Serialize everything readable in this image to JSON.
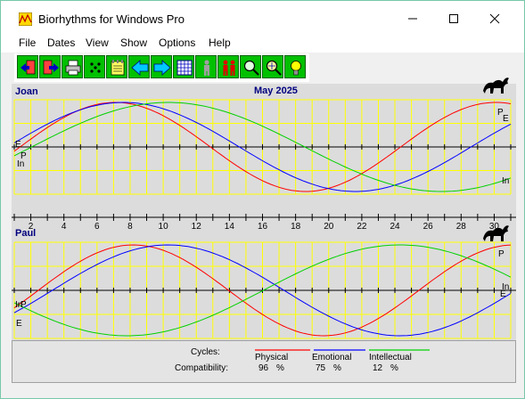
{
  "window": {
    "title": "Biorhythms for Windows Pro"
  },
  "menu": [
    "File",
    "Dates",
    "View",
    "Show",
    "Options",
    "Help"
  ],
  "toolbar": {
    "buttons": [
      {
        "icon": "exit-left-icon"
      },
      {
        "icon": "exit-right-icon"
      },
      {
        "icon": "printer-icon"
      },
      {
        "icon": "dice-icon"
      },
      {
        "icon": "notepad-icon"
      },
      {
        "icon": "arrow-left-icon"
      },
      {
        "icon": "arrow-right-icon"
      },
      {
        "icon": "calendar-grid-icon"
      },
      {
        "icon": "person-icon"
      },
      {
        "icon": "couple-icon"
      },
      {
        "icon": "magnify-icon"
      },
      {
        "icon": "magnify-grid-icon"
      },
      {
        "icon": "lightbulb-icon"
      }
    ]
  },
  "chart": {
    "month_label": "May 2025",
    "day_ticks": [
      "2",
      "4",
      "6",
      "8",
      "10",
      "12",
      "14",
      "16",
      "18",
      "20",
      "22",
      "24",
      "26",
      "28",
      "30"
    ],
    "colors": {
      "physical": "#ff0000",
      "emotional": "#0000ff",
      "intellectual": "#00d000",
      "grid": "#ffff00",
      "background": "#dcdcdc"
    }
  },
  "persons": [
    {
      "name": "Joan",
      "left_labels": {
        "top": "E",
        "bottom_a": "P",
        "bottom_b": "In"
      },
      "right_labels": {
        "a": "P",
        "b": "E",
        "c": "In"
      }
    },
    {
      "name": "Paul",
      "left_labels": {
        "top": "In",
        "bottom_a": "P",
        "bottom_b": "E"
      },
      "right_labels": {
        "a": "P",
        "b": "In",
        "c": "E"
      }
    }
  ],
  "chart_data": {
    "type": "line",
    "x": [
      1,
      2,
      3,
      4,
      5,
      6,
      7,
      8,
      9,
      10,
      11,
      12,
      13,
      14,
      15,
      16,
      17,
      18,
      19,
      20,
      21,
      22,
      23,
      24,
      25,
      26,
      27,
      28,
      29,
      30,
      31
    ],
    "xlim": [
      1,
      31
    ],
    "ylim": [
      -1,
      1
    ],
    "panels": [
      {
        "name": "Joan",
        "series": [
          {
            "name": "Physical",
            "period": 23,
            "peak_day": 7.1
          },
          {
            "name": "Emotional",
            "period": 28,
            "peak_day": 7.6
          },
          {
            "name": "Intellectual",
            "period": 33,
            "peak_day": 10.3
          }
        ]
      },
      {
        "name": "Paul",
        "series": [
          {
            "name": "Physical",
            "period": 23,
            "peak_day": 8.2
          },
          {
            "name": "Emotional",
            "period": 28,
            "peak_day": 10.3
          },
          {
            "name": "Intellectual",
            "period": 33,
            "peak_day": 24.3
          }
        ]
      }
    ]
  },
  "legend": {
    "cycles_label": "Cycles:",
    "compat_label": "Compatibility:",
    "items": [
      {
        "name": "Physical",
        "value": "96",
        "unit": "%"
      },
      {
        "name": "Emotional",
        "value": "75",
        "unit": "%"
      },
      {
        "name": "Intellectual",
        "value": "12",
        "unit": "%"
      }
    ]
  }
}
